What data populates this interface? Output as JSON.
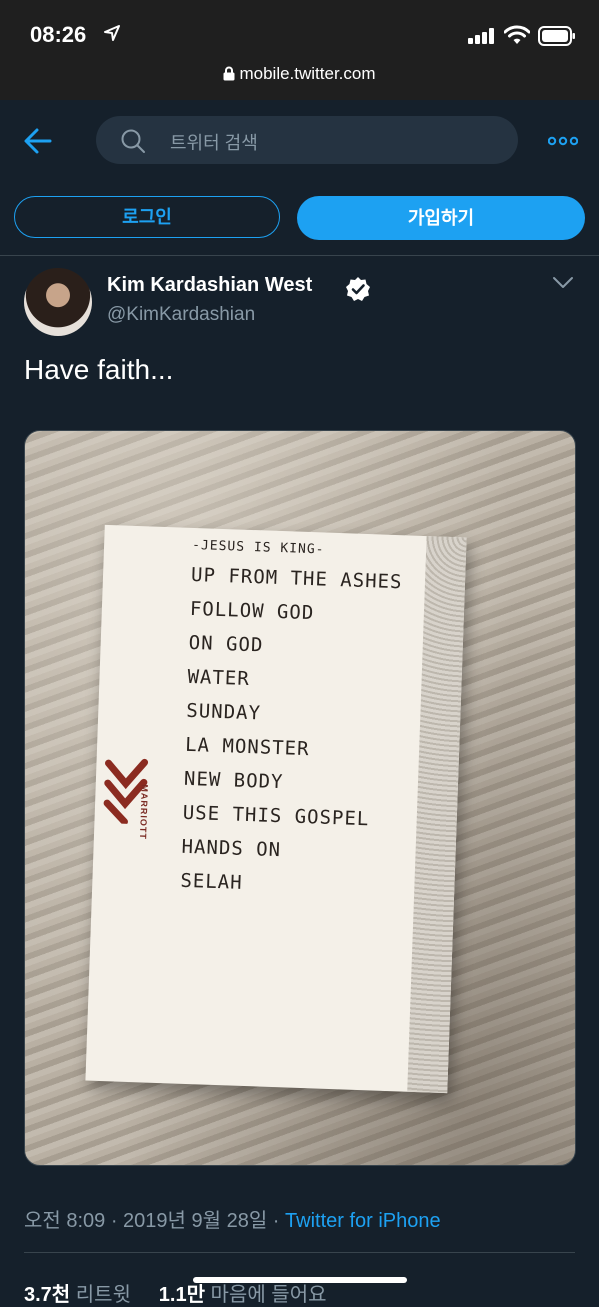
{
  "status_bar": {
    "time": "08:26",
    "url": "mobile.twitter.com"
  },
  "nav": {
    "search_placeholder": "트위터 검색",
    "login_label": "로그인",
    "signup_label": "가입하기"
  },
  "tweet": {
    "display_name": "Kim Kardashian West",
    "handle": "@KimKardashian",
    "text": "Have faith...",
    "photo": {
      "card_brand": "MARRIOTT",
      "setlist": [
        "-JESUS IS KING-",
        "UP FROM THE ASHES",
        "FOLLOW GOD",
        "ON GOD",
        "WATER",
        "SUNDAY",
        "LA MONSTER",
        "NEW BODY",
        "USE THIS GOSPEL",
        "HANDS ON",
        "SELAH"
      ]
    },
    "timestamp": "오전 8:09 · 2019년 9월 28일 · ",
    "source": "Twitter for iPhone",
    "retweets_count": "3.7천",
    "retweets_label": "리트윗",
    "likes_count": "1.1만",
    "likes_label": "마음에 들어요"
  },
  "colors": {
    "background": "#15202b",
    "accent": "#1da1f2",
    "muted_text": "#8899a6"
  },
  "icons": [
    "location-arrow-icon",
    "signal-icon",
    "wifi-icon",
    "battery-icon",
    "lock-icon",
    "back-arrow-icon",
    "search-icon",
    "more-icon",
    "verified-icon",
    "chevron-down-icon"
  ]
}
